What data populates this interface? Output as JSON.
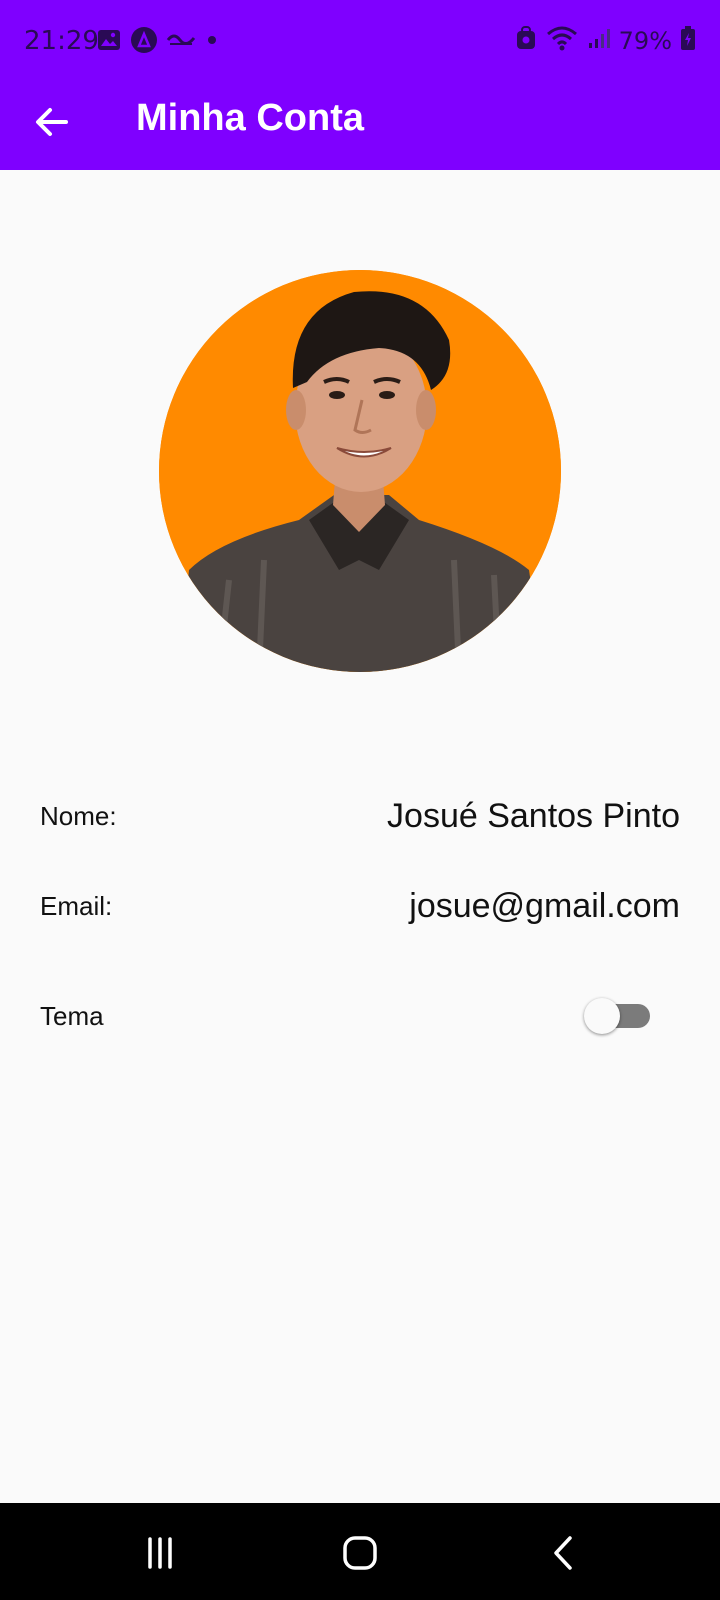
{
  "status_bar": {
    "time": "21:29",
    "battery_percent": "79%",
    "left_icons": [
      "gallery-icon",
      "app-a-icon",
      "app-small-icon",
      "dot-icon"
    ],
    "right_icons": [
      "lock-icon",
      "wifi-icon",
      "signal-icon",
      "battery-icon"
    ]
  },
  "app_bar": {
    "title": "Minha Conta",
    "background": "#7f00ff"
  },
  "profile": {
    "avatar_background": "#ff8a00"
  },
  "fields": {
    "name_label": "Nome:",
    "name_value": "Josué Santos Pinto",
    "email_label": "Email:",
    "email_value": "josue@gmail.com",
    "theme_label": "Tema",
    "theme_enabled": false
  },
  "nav_bar": {
    "buttons": [
      "recent-apps-icon",
      "home-icon",
      "back-icon"
    ]
  }
}
